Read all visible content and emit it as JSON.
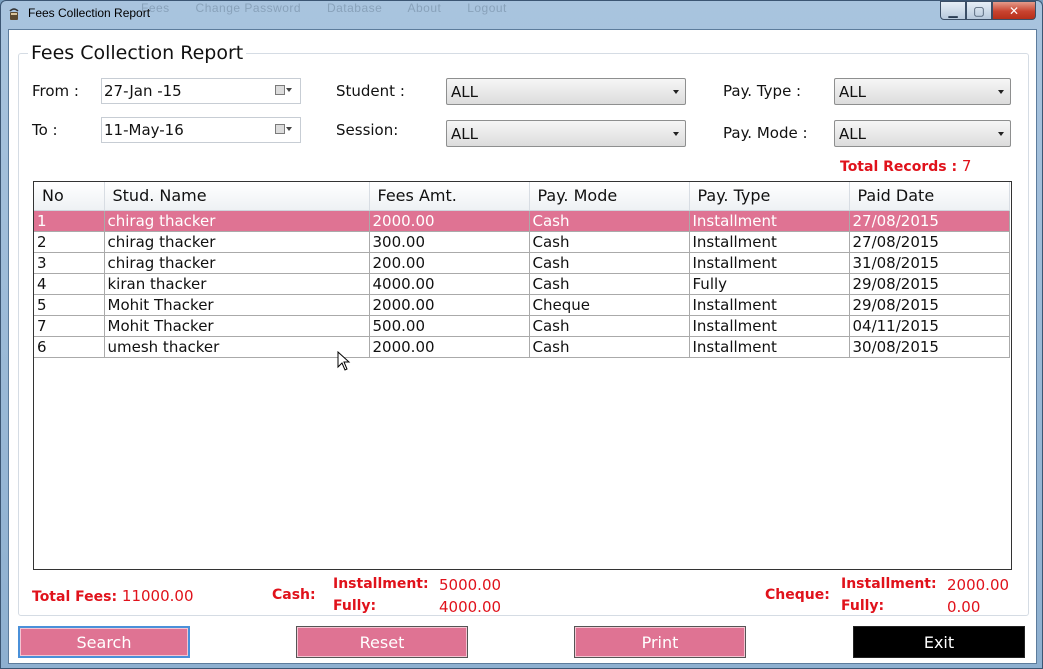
{
  "window": {
    "title": "Fees Collection Report",
    "menu_ghost": [
      "Fees",
      "Change Password",
      "Database",
      "About",
      "Logout"
    ]
  },
  "report": {
    "group_title": "Fees Collection Report",
    "filters": {
      "from_label": "From :",
      "from_value": "27-Jan -15",
      "to_label": "To :",
      "to_value": "11-May-16",
      "student_label": "Student :",
      "student_value": "ALL",
      "session_label": "Session:",
      "session_value": "ALL",
      "pay_type_label": "Pay. Type :",
      "pay_type_value": "ALL",
      "pay_mode_label": "Pay. Mode :",
      "pay_mode_value": "ALL"
    },
    "total_records_label": "Total Records :",
    "total_records_value": "7",
    "columns": [
      "No",
      "Stud. Name",
      "Fees Amt.",
      "Pay. Mode",
      "Pay. Type",
      "Paid Date"
    ],
    "rows": [
      [
        "1",
        "chirag thacker",
        "2000.00",
        "Cash",
        "Installment",
        "27/08/2015"
      ],
      [
        "2",
        "chirag thacker",
        "300.00",
        "Cash",
        "Installment",
        "27/08/2015"
      ],
      [
        "3",
        "chirag thacker",
        "200.00",
        "Cash",
        "Installment",
        "31/08/2015"
      ],
      [
        "4",
        "kiran thacker",
        "4000.00",
        "Cash",
        "Fully",
        "29/08/2015"
      ],
      [
        "5",
        "Mohit Thacker",
        "2000.00",
        "Cheque",
        "Installment",
        "29/08/2015"
      ],
      [
        "7",
        "Mohit Thacker",
        "500.00",
        "Cash",
        "Installment",
        "04/11/2015"
      ],
      [
        "6",
        "umesh thacker",
        "2000.00",
        "Cash",
        "Installment",
        "30/08/2015"
      ]
    ],
    "selected_row": 0,
    "summary": {
      "total_fees_label": "Total Fees:",
      "total_fees_value": "11000.00",
      "cash_label": "Cash:",
      "cash_installment_label": "Installment:",
      "cash_installment_value": "5000.00",
      "cash_fully_label": "Fully:",
      "cash_fully_value": "4000.00",
      "cheque_label": "Cheque:",
      "cheque_installment_label": "Installment:",
      "cheque_installment_value": "2000.00",
      "cheque_fully_label": "Fully:",
      "cheque_fully_value": "0.00"
    }
  },
  "buttons": {
    "search": "Search",
    "reset": "Reset",
    "print": "Print",
    "exit": "Exit"
  },
  "colors": {
    "accent_pink": "#df7393",
    "total_red": "#e0121b"
  }
}
